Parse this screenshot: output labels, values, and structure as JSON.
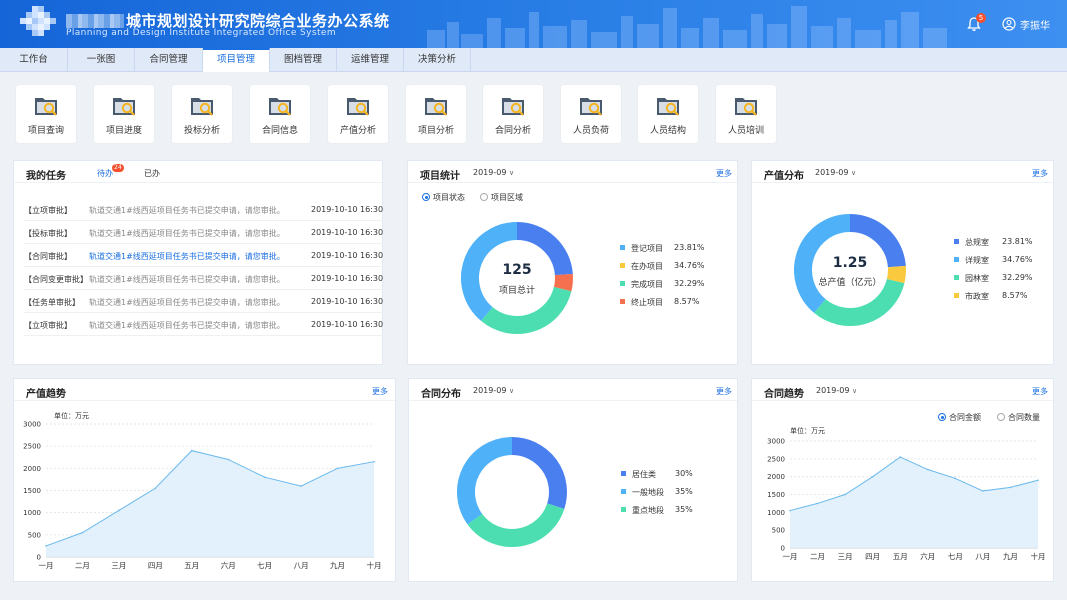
{
  "header": {
    "title": "城市规划设计研究院综合业务办公系统",
    "subtitle": "Planning and Design Institute Integrated Office System",
    "notification_count": "5",
    "user_name": "李振华",
    "icons": [
      "logo-mosaic",
      "bell-icon",
      "user-icon"
    ]
  },
  "nav": {
    "tabs": [
      "工作台",
      "一张图",
      "合同管理",
      "项目管理",
      "图档管理",
      "运维管理",
      "决策分析"
    ],
    "active": "项目管理"
  },
  "quick_links": [
    "项目查询",
    "项目进度",
    "投标分析",
    "合同信息",
    "产值分析",
    "项目分析",
    "合同分析",
    "人员负荷",
    "人员结构",
    "人员培训"
  ],
  "tasks": {
    "title": "我的任务",
    "tab_todo": "待办",
    "todo_count": "24",
    "tab_done": "已办",
    "rows": [
      {
        "type": "【立项审批】",
        "text": "轨道交通1#线西延项目任务书已提交申请，请您审批。",
        "time": "2019-10-10  16:30"
      },
      {
        "type": "【投标审批】",
        "text": "轨道交通1#线西延项目任务书已提交申请，请您审批。",
        "time": "2019-10-10  16:30"
      },
      {
        "type": "【合同审批】",
        "text": "轨道交通1#线西延项目任务书已提交申请，请您审批。",
        "time": "2019-10-10  16:30"
      },
      {
        "type": "【合同变更审批】",
        "text": "轨道交通1#线西延项目任务书已提交申请，请您审批。",
        "time": "2019-10-10  16:30"
      },
      {
        "type": "【任务单审批】",
        "text": "轨道交通1#线西延项目任务书已提交申请，请您审批。",
        "time": "2019-10-10  16:30"
      },
      {
        "type": "【立项审批】",
        "text": "轨道交通1#线西延项目任务书已提交申请，请您审批。",
        "time": "2019-10-10  16:30"
      }
    ]
  },
  "project_stats": {
    "title": "项目统计",
    "date": "2019-09",
    "more": "更多",
    "radio_on": "项目状态",
    "radio_off": "项目区域",
    "center_value": "125",
    "center_label": "项目总计"
  },
  "output_dist": {
    "title": "产值分布",
    "date": "2019-09",
    "more": "更多",
    "center_value": "1.25",
    "center_label": "总产值（亿元）"
  },
  "output_trend": {
    "title": "产值趋势",
    "more": "更多",
    "unit": "单位：万元"
  },
  "contract_dist": {
    "title": "合同分布",
    "date": "2019-09",
    "more": "更多"
  },
  "contract_trend": {
    "title": "合同趋势",
    "date": "2019-09",
    "more": "更多",
    "radio_on": "合同金额",
    "radio_off": "合同数量",
    "unit": "单位：万元"
  },
  "colors": {
    "blue": "#4a7ff0",
    "sky": "#4fb1f7",
    "green": "#4cdeb0",
    "yellow": "#fbc93d",
    "red": "#f5704f",
    "line": "#6ab9ec"
  },
  "chart_data": [
    {
      "type": "pie",
      "title": "项目统计",
      "labels": [
        "登记项目",
        "在办项目",
        "完成项目",
        "终止项目"
      ],
      "value_labels": [
        "23.81%",
        "34.76%",
        "32.29%",
        "8.57%"
      ],
      "slices": [
        {
          "label": "登记项目",
          "value": 23.81,
          "color": "#4a7ff0"
        },
        {
          "label": "终止项目",
          "value": 5,
          "color": "#f5704f"
        },
        {
          "label": "完成项目",
          "value": 32.29,
          "color": "#4cdeb0"
        },
        {
          "label": "在办项目",
          "value": 38.9,
          "color": "#4fb1f7"
        }
      ],
      "legend_colors": [
        "#4fb1f7",
        "#fbc93d",
        "#4cdeb0",
        "#f5704f"
      ]
    },
    {
      "type": "pie",
      "title": "产值分布",
      "labels": [
        "总规室",
        "详规室",
        "园林室",
        "市政室"
      ],
      "value_labels": [
        "23.81%",
        "34.76%",
        "32.29%",
        "8.57%"
      ],
      "slices": [
        {
          "label": "总规室",
          "value": 23.81,
          "color": "#4a7ff0"
        },
        {
          "label": "市政室",
          "value": 5,
          "color": "#fbc93d"
        },
        {
          "label": "园林室",
          "value": 32.29,
          "color": "#4cdeb0"
        },
        {
          "label": "详规室",
          "value": 38.9,
          "color": "#4fb1f7"
        }
      ],
      "legend_colors": [
        "#4a7ff0",
        "#4fb1f7",
        "#4cdeb0",
        "#fbc93d"
      ]
    },
    {
      "type": "area",
      "title": "产值趋势",
      "categories": [
        "一月",
        "二月",
        "三月",
        "四月",
        "五月",
        "六月",
        "七月",
        "八月",
        "九月",
        "十月"
      ],
      "values": [
        250,
        550,
        1050,
        1550,
        2400,
        2200,
        1800,
        1600,
        2000,
        2150
      ],
      "ylim": [
        0,
        3000
      ],
      "yticks": [
        0,
        500,
        1000,
        1500,
        2000,
        2500,
        3000
      ],
      "grid": true
    },
    {
      "type": "pie",
      "title": "合同分布",
      "labels": [
        "居住类",
        "一般地段",
        "重点地段"
      ],
      "value_labels": [
        "30%",
        "35%",
        "35%"
      ],
      "slices": [
        {
          "label": "居住类",
          "value": 30,
          "color": "#4a7ff0"
        },
        {
          "label": "重点地段",
          "value": 35,
          "color": "#4cdeb0"
        },
        {
          "label": "一般地段",
          "value": 35,
          "color": "#4fb1f7"
        }
      ],
      "legend_colors": [
        "#4a7ff0",
        "#4fb1f7",
        "#4cdeb0"
      ]
    },
    {
      "type": "area",
      "title": "合同趋势",
      "categories": [
        "一月",
        "二月",
        "三月",
        "四月",
        "五月",
        "六月",
        "七月",
        "八月",
        "九月",
        "十月"
      ],
      "values": [
        1050,
        1250,
        1500,
        2000,
        2550,
        2200,
        1950,
        1600,
        1700,
        1900
      ],
      "ylim": [
        0,
        3000
      ],
      "yticks": [
        0,
        500,
        1000,
        1500,
        2000,
        2500,
        3000
      ],
      "grid": true
    }
  ]
}
